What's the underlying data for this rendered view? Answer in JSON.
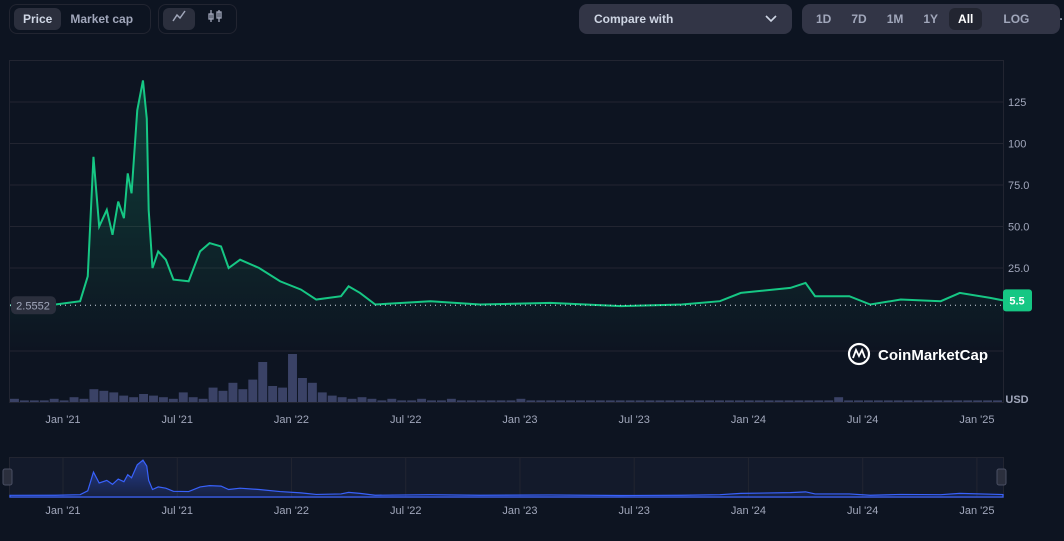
{
  "toolbar": {
    "price": "Price",
    "market_cap": "Market cap",
    "line_icon": "line-chart-icon",
    "candle_icon": "candlestick-icon",
    "compare": "Compare with",
    "ranges": [
      "1D",
      "7D",
      "1M",
      "1Y",
      "All"
    ],
    "log": "LOG",
    "more": "···"
  },
  "brand": "CoinMarketCap",
  "colors": {
    "line": "#16c784",
    "volume": "#3a4266",
    "nav": "#3861fb"
  },
  "chart_data": {
    "type": "line",
    "title": "",
    "ylabel": "USD",
    "ylim": [
      0,
      140
    ],
    "yticks": [
      25,
      50,
      75,
      100,
      125
    ],
    "ytick_labels": [
      "25.0",
      "50.0",
      "75.0",
      "100",
      "125"
    ],
    "xticks": [
      0,
      6,
      12,
      18,
      24,
      30,
      36,
      42,
      48
    ],
    "xtick_labels": [
      "Jan '21",
      "Jul '21",
      "Jan '22",
      "Jul '22",
      "Jan '23",
      "Jul '23",
      "Jan '24",
      "Jul '24",
      "Jan '25"
    ],
    "x_unit": "months since Jan 2021",
    "start_value_label": "2.5552",
    "current_value_label": "5.5",
    "series": [
      {
        "name": "Price",
        "x": [
          -2.8,
          -0.4,
          0.9,
          1.3,
          1.6,
          1.9,
          2.3,
          2.6,
          2.9,
          3.2,
          3.4,
          3.6,
          3.9,
          4.2,
          4.4,
          4.5,
          4.7,
          5.0,
          5.4,
          5.8,
          6.6,
          7.2,
          7.7,
          8.3,
          8.7,
          9.3,
          10.3,
          11.4,
          12.5,
          13.3,
          14.6,
          15.0,
          15.6,
          16.4,
          19.3,
          21.9,
          25.6,
          29.3,
          32.5,
          34.5,
          35.6,
          38.2,
          39.0,
          39.5,
          41.3,
          42.4,
          44.0,
          46.1,
          47.1,
          48.7,
          49.4
        ],
        "values": [
          2.55,
          3,
          5,
          20,
          92,
          50,
          60,
          45,
          65,
          55,
          82,
          70,
          120,
          138,
          115,
          60,
          25,
          35,
          30,
          18,
          17,
          35,
          40,
          38,
          25,
          30,
          25,
          17,
          12,
          6,
          8,
          14,
          10,
          3,
          5,
          3,
          4,
          2,
          3,
          5,
          10,
          13,
          16,
          8,
          8,
          3,
          6,
          5,
          10,
          7,
          5.5
        ]
      }
    ],
    "volume": [
      2,
      1,
      1,
      1,
      2,
      1,
      3,
      2,
      8,
      7,
      6,
      4,
      3,
      5,
      4,
      3,
      2,
      6,
      3,
      2,
      9,
      7,
      12,
      8,
      14,
      25,
      10,
      9,
      30,
      15,
      12,
      6,
      4,
      3,
      2,
      3,
      2,
      1,
      2,
      1,
      1,
      2,
      1,
      1,
      2,
      1,
      1,
      1,
      1,
      1,
      1,
      2,
      1,
      1,
      1,
      1,
      1,
      1,
      1,
      1,
      1,
      1,
      1,
      1,
      1,
      1,
      1,
      1,
      1,
      1,
      1,
      1,
      1,
      1,
      1,
      1,
      1,
      1,
      1,
      1,
      1,
      1,
      1,
      3,
      1,
      1,
      1,
      1,
      1,
      1,
      1,
      1,
      1,
      1,
      1,
      1,
      1,
      1,
      1,
      1
    ]
  }
}
